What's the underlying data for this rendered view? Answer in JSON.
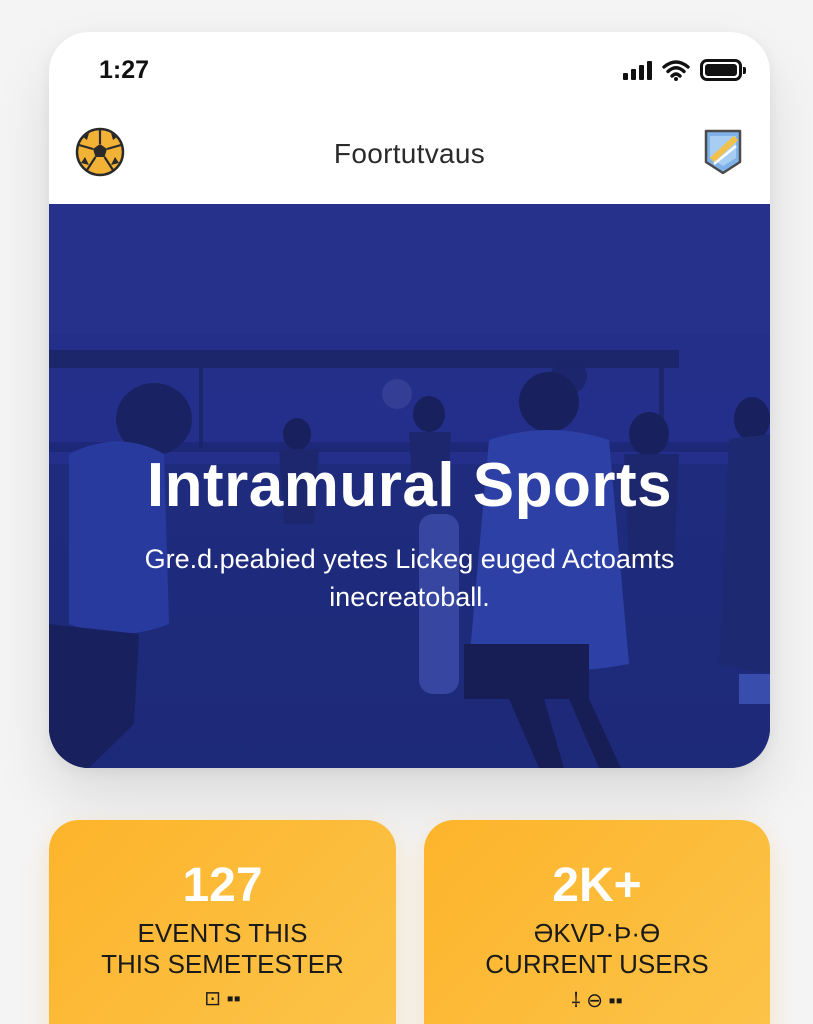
{
  "status_bar": {
    "time": "1:27",
    "signal_bars": 4,
    "battery_level": 1.0
  },
  "app_bar": {
    "title": "Foortutvaus",
    "left_icon": "soccer-ball-icon",
    "right_icon": "badge-icon"
  },
  "hero": {
    "title": "Intramural Sports",
    "subtitle_line1": "Gre.d.peabied yetes Lickeg euged Actoamts",
    "subtitle_line2": "inecreatoball."
  },
  "stats": [
    {
      "value": "127",
      "label_line1": "EVENTS THIS",
      "label_line2": "THIS SEMETESTER",
      "glyphs": "⊡ ▪▪"
    },
    {
      "value": "2K+",
      "label_line1": "ƏKVP·Þ·Ɵ",
      "label_line2": "CURRENT USERS",
      "glyphs": "⸸ ⊖ ▪▪"
    }
  ],
  "colors": {
    "hero_blue": "#24318c",
    "card_amber": "#fdb42b",
    "ball_gold": "#f2b236"
  }
}
